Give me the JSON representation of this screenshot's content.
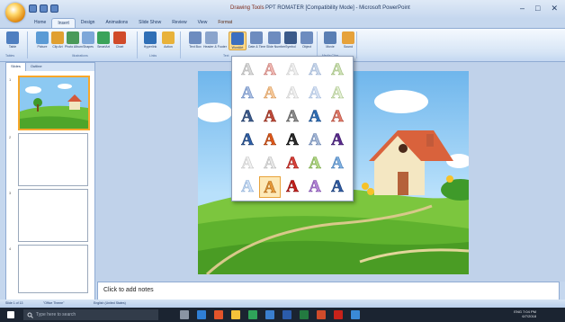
{
  "window": {
    "title": "PPT ROMATER [Compatibility Mode] - Microsoft PowerPoint",
    "context_tool": "Drawing Tools",
    "controls": [
      "–",
      "□",
      "✕"
    ]
  },
  "tabs": [
    {
      "label": "Home",
      "active": false
    },
    {
      "label": "Insert",
      "active": true
    },
    {
      "label": "Design",
      "active": false
    },
    {
      "label": "Animations",
      "active": false
    },
    {
      "label": "Slide Show",
      "active": false
    },
    {
      "label": "Review",
      "active": false
    },
    {
      "label": "View",
      "active": false
    },
    {
      "label": "Format",
      "active": false
    }
  ],
  "ribbon": {
    "buttons": [
      {
        "label": "Table",
        "icon": "table-icon",
        "color": "#4f7fc0"
      },
      {
        "label": "Picture",
        "icon": "picture-icon",
        "color": "#5b9bd5"
      },
      {
        "label": "Clip Art",
        "icon": "clipart-icon",
        "color": "#e0a030"
      },
      {
        "label": "Photo Album",
        "icon": "photo-album-icon",
        "color": "#4a9a5a"
      },
      {
        "label": "Shapes",
        "icon": "shapes-icon",
        "color": "#7da7d9"
      },
      {
        "label": "SmartArt",
        "icon": "smartart-icon",
        "color": "#3aa35a"
      },
      {
        "label": "Chart",
        "icon": "chart-icon",
        "color": "#d04b2a"
      },
      {
        "label": "Hyperlink",
        "icon": "hyperlink-icon",
        "color": "#2f6fb6"
      },
      {
        "label": "Action",
        "icon": "action-icon",
        "color": "#e8b23a"
      },
      {
        "label": "Text Box",
        "icon": "textbox-icon",
        "color": "#6d8cbf"
      },
      {
        "label": "Header & Footer",
        "icon": "header-footer-icon",
        "color": "#8aa4cc"
      },
      {
        "label": "WordArt",
        "icon": "wordart-icon",
        "color": "#3b6fc0"
      },
      {
        "label": "Date & Time",
        "icon": "date-time-icon",
        "color": "#6d8cbf"
      },
      {
        "label": "Slide Number",
        "icon": "slide-number-icon",
        "color": "#6d8cbf"
      },
      {
        "label": "Symbol",
        "icon": "symbol-icon",
        "color": "#3b5a8a"
      },
      {
        "label": "Object",
        "icon": "object-icon",
        "color": "#6d8cbf"
      },
      {
        "label": "Movie",
        "icon": "movie-icon",
        "color": "#5a7fb4"
      },
      {
        "label": "Sound",
        "icon": "sound-icon",
        "color": "#e6a23a"
      }
    ],
    "groups": [
      "Tables",
      "Illustrations",
      "Links",
      "Text",
      "Media Clips"
    ]
  },
  "left_pane": {
    "tabs": [
      "Slides",
      "Outline"
    ],
    "slide_numbers": [
      "1",
      "2",
      "3",
      "4"
    ]
  },
  "notes_placeholder": "Click to add notes",
  "status": {
    "slide": "Slide 1 of 13",
    "theme": "\"Office Theme\"",
    "language": "English (United States)"
  },
  "taskbar": {
    "search_placeholder": "Type here to search",
    "time": "7:04 PM",
    "date": "6/7/2018",
    "lang": "ENG"
  },
  "wordart_gallery": {
    "glyph": "A",
    "styles": [
      {
        "color": "#d8d8d8",
        "stroke": "#b0b0b0"
      },
      {
        "color": "#f0b9b4",
        "stroke": "#c87a74"
      },
      {
        "color": "#efefef",
        "stroke": "#d0d0d0"
      },
      {
        "color": "#c9d7ea",
        "stroke": "#9fb4d4"
      },
      {
        "color": "#cfe1b8",
        "stroke": "#9fbd7c"
      },
      {
        "color": "#a9bde0",
        "stroke": "#6c8cc2"
      },
      {
        "color": "#f6c99a",
        "stroke": "#d89a5c"
      },
      {
        "color": "#f0f0f0",
        "stroke": "#cfcfcf"
      },
      {
        "color": "#d7e2f2",
        "stroke": "#a7bddd"
      },
      {
        "color": "#e4efd5",
        "stroke": "#aac58a"
      },
      {
        "color": "#3b5a8a",
        "stroke": "#203a66"
      },
      {
        "color": "#c04a3a",
        "stroke": "#8a2a1a"
      },
      {
        "color": "#8a8a8a",
        "stroke": "#5a5a5a"
      },
      {
        "color": "#2f6fb6",
        "stroke": "#1a4a86"
      },
      {
        "color": "#e07a6a",
        "stroke": "#b04a3a"
      },
      {
        "color": "#2e5fa8",
        "stroke": "#1a3a6a"
      },
      {
        "color": "#e0581a",
        "stroke": "#a03a0a"
      },
      {
        "color": "#2b2b2b",
        "stroke": "#000000"
      },
      {
        "color": "#a7b9d6",
        "stroke": "#6a84b0"
      },
      {
        "color": "#5a2a8a",
        "stroke": "#3a1a6a"
      },
      {
        "color": "#f0f0f0",
        "stroke": "#c8c8c8"
      },
      {
        "color": "#e8e8e8",
        "stroke": "#b8b8b8"
      },
      {
        "color": "#d8403a",
        "stroke": "#a0201a"
      },
      {
        "color": "#b5d98a",
        "stroke": "#7aa84a"
      },
      {
        "color": "#7fb0e0",
        "stroke": "#4a7fb8"
      },
      {
        "color": "#cfe0f5",
        "stroke": "#8fb0d8"
      },
      {
        "color": "#e89a3a",
        "stroke": "#b06a1a",
        "selected": true
      },
      {
        "color": "#c2201a",
        "stroke": "#8a0a0a"
      },
      {
        "color": "#b586d6",
        "stroke": "#7a4aa8"
      },
      {
        "color": "#2f5aa0",
        "stroke": "#163a76"
      }
    ]
  }
}
